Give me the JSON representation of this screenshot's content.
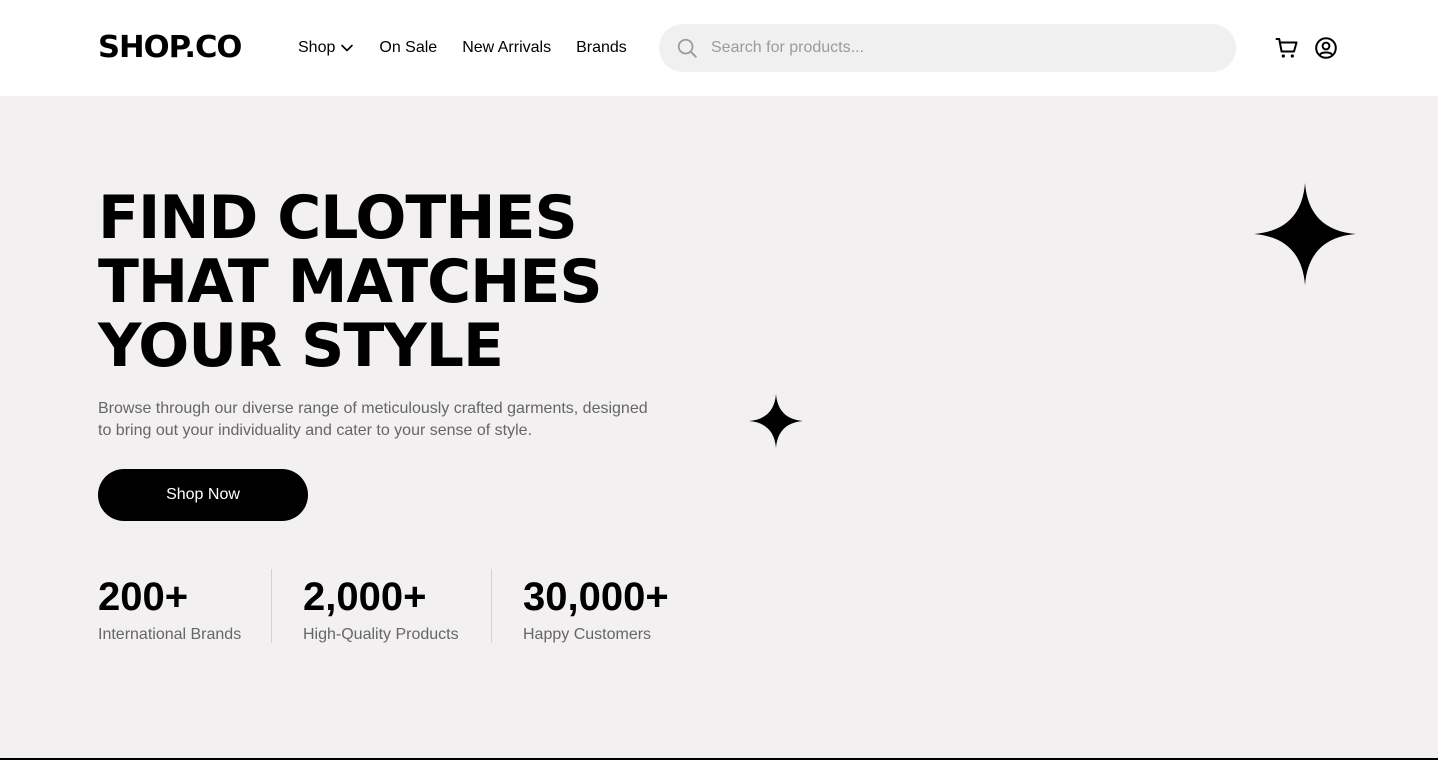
{
  "brand": {
    "logo_text": "SHOP.CO"
  },
  "nav": {
    "items": [
      {
        "label": "Shop",
        "has_dropdown": true
      },
      {
        "label": "On Sale"
      },
      {
        "label": "New Arrivals"
      },
      {
        "label": "Brands"
      }
    ]
  },
  "search": {
    "placeholder": "Search for products...",
    "value": "",
    "icon": "search-icon"
  },
  "header_icons": {
    "cart": "cart-icon",
    "account": "account-icon"
  },
  "hero": {
    "title_lines": [
      "FIND CLOTHES",
      "THAT MATCHES",
      "YOUR STYLE"
    ],
    "subtitle": "Browse through our diverse range of meticulously crafted garments, designed to bring out your individuality and cater to your sense of style.",
    "cta_label": "Shop Now"
  },
  "stats": [
    {
      "value": "200+",
      "label": "International Brands"
    },
    {
      "value": "2,000+",
      "label": "High-Quality Products"
    },
    {
      "value": "30,000+",
      "label": "Happy Customers"
    }
  ],
  "decorations": {
    "large_star": "sparkle-icon",
    "small_star": "sparkle-icon"
  },
  "colors": {
    "hero_background": "#F2F0F1",
    "header_background": "#FFFFFF",
    "primary": "#000000",
    "muted_text": "#666666",
    "search_background": "#F0F0F0"
  }
}
